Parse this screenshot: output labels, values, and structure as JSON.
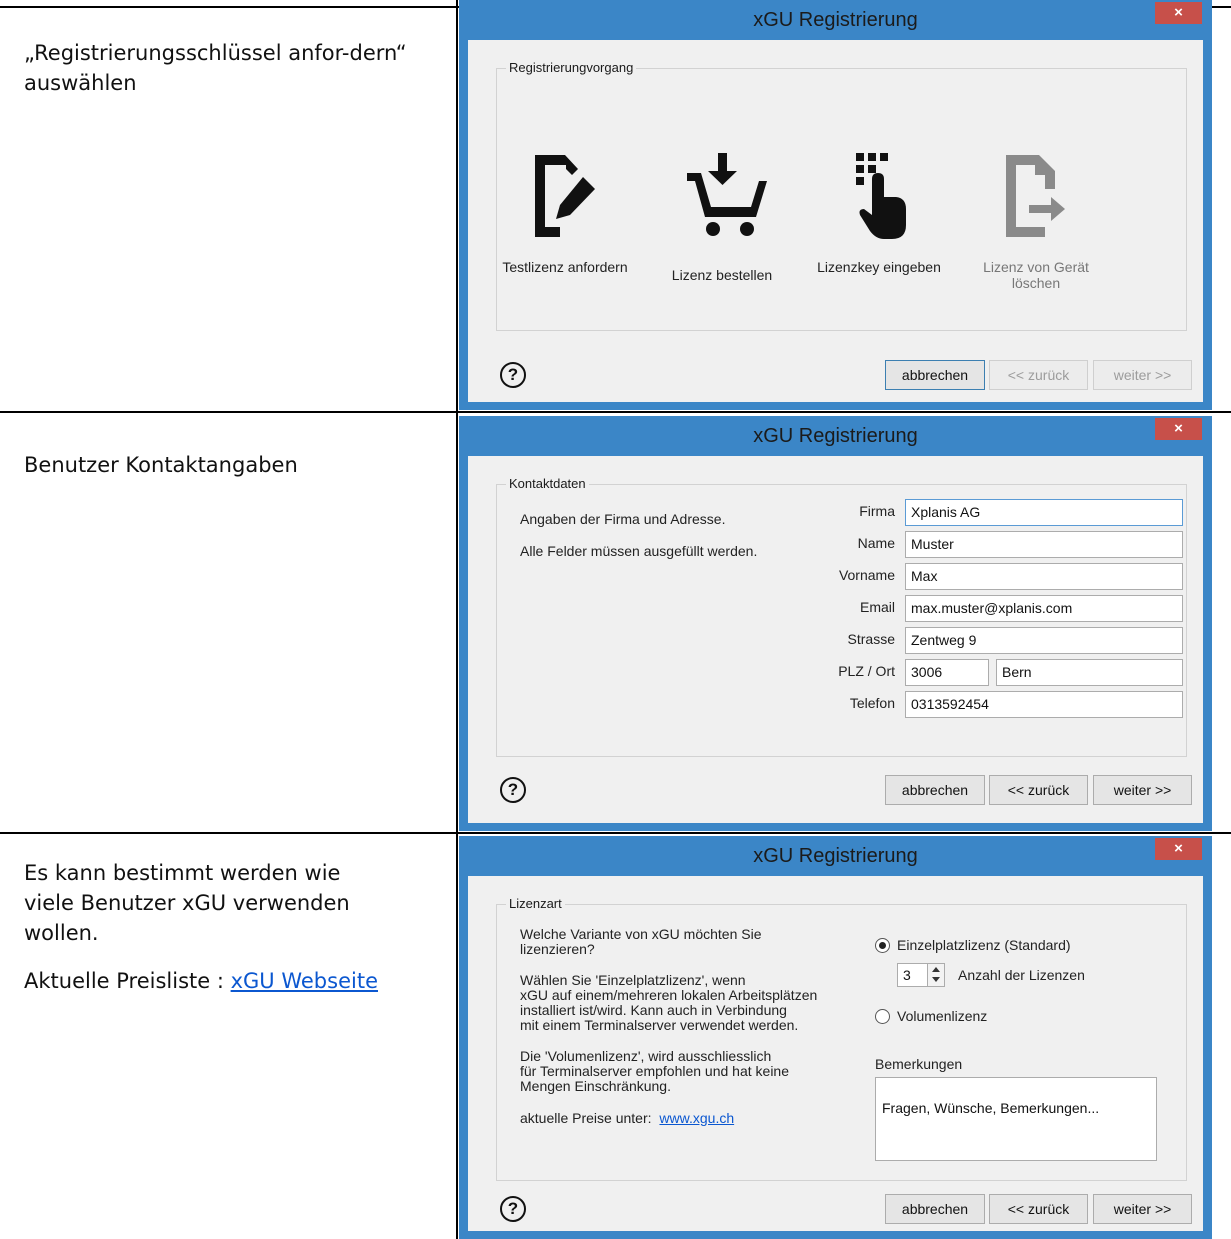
{
  "rows": [
    {
      "description": [
        "„Registrierungsschlüssel anfor-dern“ auswählen"
      ],
      "window": {
        "title": "xGU Registrierung",
        "close_symbol": "×",
        "group_title": "Registrierungvorgang",
        "tiles": [
          {
            "icon": "document-edit-icon",
            "label": "Testlizenz anfordern"
          },
          {
            "icon": "shopping-cart-download-icon",
            "label": "Lizenz bestellen"
          },
          {
            "icon": "keypad-touch-icon",
            "label": "Lizenzkey eingeben"
          },
          {
            "icon": "document-export-icon",
            "label": "Lizenz von Gerät löschen"
          }
        ],
        "help_symbol": "?",
        "buttons": {
          "cancel": "abbrechen",
          "back": "<< zurück",
          "next": "weiter >>"
        }
      }
    },
    {
      "description": [
        "Benutzer Kontaktangaben"
      ],
      "window": {
        "title": "xGU Registrierung",
        "close_symbol": "×",
        "group_title": "Kontaktdaten",
        "intro_lines": [
          "Angaben der Firma und Adresse.",
          "Alle Felder müssen ausgefüllt werden."
        ],
        "fields": {
          "firma": {
            "label": "Firma",
            "value": "Xplanis AG"
          },
          "name": {
            "label": "Name",
            "value": "Muster"
          },
          "vorname": {
            "label": "Vorname",
            "value": "Max"
          },
          "email": {
            "label": "Email",
            "value": "max.muster@xplanis.com"
          },
          "strasse": {
            "label": "Strasse",
            "value": "Zentweg 9"
          },
          "plz_ort": {
            "label": "PLZ / Ort",
            "plz": "3006",
            "ort": "Bern"
          },
          "telefon": {
            "label": "Telefon",
            "value": "0313592454"
          }
        },
        "help_symbol": "?",
        "buttons": {
          "cancel": "abbrechen",
          "back": "<< zurück",
          "next": "weiter >>"
        }
      }
    },
    {
      "description": [
        "Es kann bestimmt werden wie viele Benutzer xGU verwenden wollen."
      ],
      "pricelist_prefix": "Aktuelle Preisliste : ",
      "pricelist_link": "xGU Webseite",
      "window": {
        "title": "xGU Registrierung",
        "close_symbol": "×",
        "group_title": "Lizenzart",
        "para1": [
          "Welche Variante von xGU möchten Sie",
          "lizenzieren?"
        ],
        "para2": [
          "Wählen Sie 'Einzelplatzlizenz', wenn",
          "xGU auf einem/mehreren lokalen Arbeitsplätzen",
          "installiert ist/wird. Kann auch in Verbindung",
          "mit einem Terminalserver verwendet werden."
        ],
        "para3": [
          "Die 'Volumenlizenz', wird ausschliesslich",
          "für Terminalserver empfohlen und hat keine",
          "Mengen Einschränkung."
        ],
        "prices_prefix": "aktuelle Preise unter:",
        "prices_link": "www.xgu.ch",
        "radio_single": {
          "label": "Einzelplatzlizenz (Standard)",
          "checked": true
        },
        "quantity": {
          "value": "3",
          "label": "Anzahl der Lizenzen"
        },
        "radio_volume": {
          "label": "Volumenlizenz",
          "checked": false
        },
        "remarks_label": "Bemerkungen",
        "remarks_value": "Fragen, Wünsche, Bemerkungen...",
        "help_symbol": "?",
        "buttons": {
          "cancel": "abbrechen",
          "back": "<< zurück",
          "next": "weiter >>"
        }
      }
    }
  ],
  "colors": {
    "window_frame": "#3b86c7",
    "close_button": "#c7504a",
    "link": "#0b57d0"
  }
}
